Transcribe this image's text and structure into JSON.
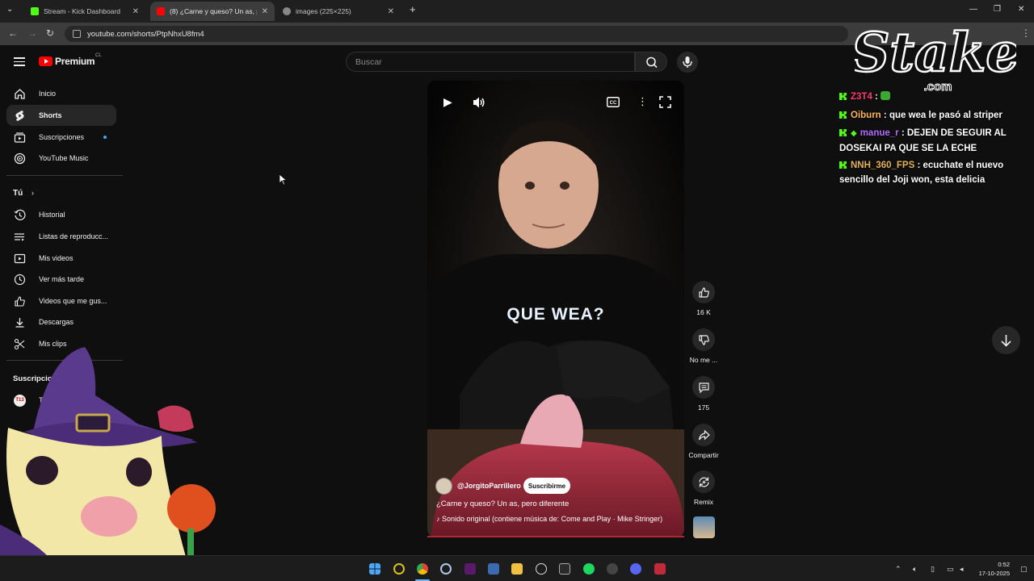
{
  "browser": {
    "tabs": [
      {
        "title": "Stream - Kick Dashboard",
        "active": false
      },
      {
        "title": "(8) ¿Carne y queso? Un as, pero",
        "active": true
      },
      {
        "title": "images (225×225)",
        "active": false
      }
    ],
    "url": "youtube.com/shorts/PtpNhxU8fm4"
  },
  "youtube": {
    "logo_text": "Premium",
    "country_code": "CL",
    "search_placeholder": "Buscar",
    "sidebar": {
      "main": [
        {
          "label": "Inicio",
          "icon": "home-icon"
        },
        {
          "label": "Shorts",
          "icon": "shorts-icon",
          "selected": true
        },
        {
          "label": "Suscripciones",
          "icon": "subscriptions-icon"
        },
        {
          "label": "YouTube Music",
          "icon": "music-icon"
        }
      ],
      "you_title": "Tú",
      "you": [
        {
          "label": "Historial",
          "icon": "history-icon"
        },
        {
          "label": "Listas de reproducc...",
          "icon": "playlists-icon"
        },
        {
          "label": "Mis videos",
          "icon": "my-videos-icon"
        },
        {
          "label": "Ver más tarde",
          "icon": "watch-later-icon"
        },
        {
          "label": "Videos que me gus...",
          "icon": "liked-icon"
        },
        {
          "label": "Descargas",
          "icon": "download-icon"
        },
        {
          "label": "Mis clips",
          "icon": "clips-icon"
        }
      ],
      "subs_title": "Suscripciones",
      "subs": [
        {
          "label": "Teletr..."
        }
      ]
    },
    "short": {
      "channel": "@JorgitoParrillero",
      "subscribe_label": "Suscribirme",
      "title": "¿Carne y queso? Un as, pero diferente",
      "sound": "Sonido original (contiene música de: Come and Play · Mike Stringer)",
      "shirt_text": "QUE WEA?"
    },
    "actions": [
      {
        "label": "16 K",
        "icon": "like-icon"
      },
      {
        "label": "No me ...",
        "icon": "dislike-icon"
      },
      {
        "label": "175",
        "icon": "comment-icon"
      },
      {
        "label": "Compartir",
        "icon": "share-icon"
      },
      {
        "label": "Remix",
        "icon": "remix-icon"
      }
    ]
  },
  "chat": [
    {
      "user": "Z3T4",
      "color": "#ff3c6f",
      "message": ""
    },
    {
      "user": "Oiburn",
      "color": "#ffb35c",
      "message": "que wea le pasó al striper"
    },
    {
      "user": "manue_r",
      "color": "#b36cff",
      "message": "DEJEN DE SEGUIR AL DOSEKAI PA QUE SE LA ECHE"
    },
    {
      "user": "NNH_360_FPS",
      "color": "#e5b25b",
      "message": "ecuchate el nuevo sencillo del Joji won, esta delicia"
    }
  ],
  "overlay": {
    "brand": "Stake",
    "brand_domain": ".com"
  },
  "taskbar": {
    "time": "0:52",
    "date": "17-10-2025"
  }
}
